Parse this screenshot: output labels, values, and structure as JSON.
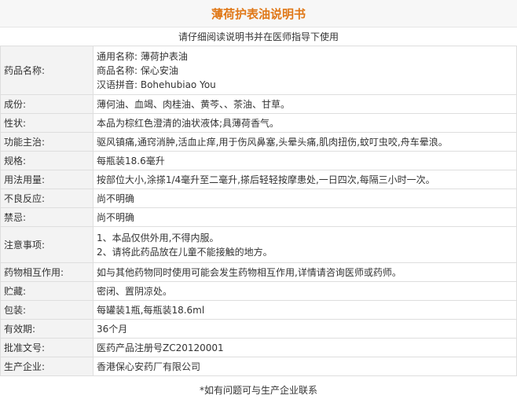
{
  "title": "薄荷护表油说明书",
  "subtitle": "请仔细阅读说明书并在医师指导下使用",
  "rows": [
    {
      "key": "药品名称:",
      "values": [
        "通用名称: 薄荷护表油",
        "商品名称: 保心安油",
        "汉语拼音: Bohehubiao You"
      ]
    },
    {
      "key": "成份:",
      "values": [
        "薄何油、血竭、肉桂油、黄芩、、茶油、甘草。"
      ]
    },
    {
      "key": "性状:",
      "values": [
        "本品为棕红色澄清的油状液体;具薄荷香气。"
      ]
    },
    {
      "key": "功能主治:",
      "values": [
        "驱风镇痛,通窍消肿,活血止痒,用于伤风鼻塞,头晕头痛,肌肉扭伤,蚊叮虫咬,舟车晕浪。"
      ]
    },
    {
      "key": "规格:",
      "values": [
        "每瓶装18.6毫升"
      ]
    },
    {
      "key": "用法用量:",
      "values": [
        "按部位大小,涂搽1/4毫升至二毫升,搽后轻轻按摩患处,一日四次,每隔三小时一次。"
      ]
    },
    {
      "key": "不良反应:",
      "values": [
        "尚不明确"
      ]
    },
    {
      "key": "禁忌:",
      "values": [
        "尚不明确"
      ]
    },
    {
      "key": "注意事项:",
      "values": [
        "1、本品仅供外用,不得内服。",
        "2、请将此药品放在儿童不能接触的地方。"
      ]
    },
    {
      "key": "药物相互作用:",
      "values": [
        "如与其他药物同时使用可能会发生药物相互作用,详情请咨询医师或药师。"
      ]
    },
    {
      "key": "贮藏:",
      "values": [
        "密闭、置阴凉处。"
      ]
    },
    {
      "key": "包装:",
      "values": [
        "每罐装1瓶,每瓶装18.6ml"
      ]
    },
    {
      "key": "有效期:",
      "values": [
        "36个月"
      ]
    },
    {
      "key": "批准文号:",
      "values": [
        "医药产品注册号ZC20120001"
      ]
    },
    {
      "key": "生产企业:",
      "values": [
        "香港保心安药厂有限公司"
      ]
    }
  ],
  "footnote": "*如有问题可与生产企业联系"
}
